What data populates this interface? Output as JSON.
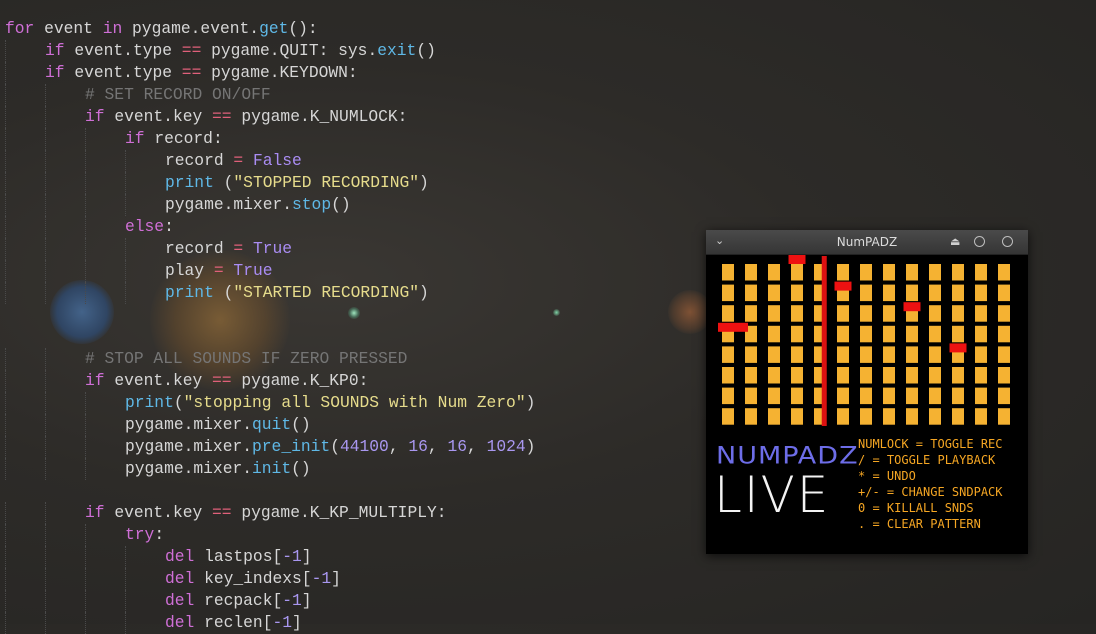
{
  "code_lines": [
    {
      "indent": 0,
      "tokens": [
        {
          "t": "for",
          "c": "kw"
        },
        {
          "t": " event "
        },
        {
          "t": "in",
          "c": "kw"
        },
        {
          "t": " pygame.event."
        },
        {
          "t": "get",
          "c": "fn"
        },
        {
          "t": "():"
        }
      ]
    },
    {
      "indent": 1,
      "tokens": [
        {
          "t": "if",
          "c": "kw"
        },
        {
          "t": " event.type "
        },
        {
          "t": "==",
          "c": "op"
        },
        {
          "t": " pygame.QUIT: sys."
        },
        {
          "t": "exit",
          "c": "fn"
        },
        {
          "t": "()"
        }
      ]
    },
    {
      "indent": 1,
      "tokens": [
        {
          "t": "if",
          "c": "kw"
        },
        {
          "t": " event.type "
        },
        {
          "t": "==",
          "c": "op"
        },
        {
          "t": " pygame.KEYDOWN:"
        }
      ]
    },
    {
      "indent": 2,
      "tokens": [
        {
          "t": "# SET RECORD ON/OFF",
          "c": "cmt"
        }
      ]
    },
    {
      "indent": 2,
      "tokens": [
        {
          "t": "if",
          "c": "kw"
        },
        {
          "t": " event.key "
        },
        {
          "t": "==",
          "c": "op"
        },
        {
          "t": " pygame.K_NUMLOCK:"
        }
      ]
    },
    {
      "indent": 3,
      "tokens": [
        {
          "t": "if",
          "c": "kw"
        },
        {
          "t": " record:"
        }
      ]
    },
    {
      "indent": 4,
      "tokens": [
        {
          "t": "record "
        },
        {
          "t": "=",
          "c": "op"
        },
        {
          "t": " "
        },
        {
          "t": "False",
          "c": "const"
        }
      ]
    },
    {
      "indent": 4,
      "tokens": [
        {
          "t": "print",
          "c": "fn"
        },
        {
          "t": " ("
        },
        {
          "t": "\"STOPPED RECORDING\"",
          "c": "str"
        },
        {
          "t": ")"
        }
      ]
    },
    {
      "indent": 4,
      "tokens": [
        {
          "t": "pygame.mixer."
        },
        {
          "t": "stop",
          "c": "fn"
        },
        {
          "t": "()"
        }
      ]
    },
    {
      "indent": 3,
      "tokens": [
        {
          "t": "else",
          "c": "kw"
        },
        {
          "t": ":"
        }
      ]
    },
    {
      "indent": 4,
      "tokens": [
        {
          "t": "record "
        },
        {
          "t": "=",
          "c": "op"
        },
        {
          "t": " "
        },
        {
          "t": "True",
          "c": "const"
        }
      ]
    },
    {
      "indent": 4,
      "tokens": [
        {
          "t": "play "
        },
        {
          "t": "=",
          "c": "op"
        },
        {
          "t": " "
        },
        {
          "t": "True",
          "c": "const"
        }
      ]
    },
    {
      "indent": 4,
      "tokens": [
        {
          "t": "print",
          "c": "fn"
        },
        {
          "t": " ("
        },
        {
          "t": "\"STARTED RECORDING\"",
          "c": "str"
        },
        {
          "t": ")"
        }
      ]
    },
    {
      "indent": 0,
      "tokens": []
    },
    {
      "indent": 0,
      "tokens": []
    },
    {
      "indent": 2,
      "tokens": [
        {
          "t": "# STOP ALL SOUNDS IF ZERO PRESSED",
          "c": "cmt"
        }
      ]
    },
    {
      "indent": 2,
      "tokens": [
        {
          "t": "if",
          "c": "kw"
        },
        {
          "t": " event.key "
        },
        {
          "t": "==",
          "c": "op"
        },
        {
          "t": " pygame.K_KP0:"
        }
      ]
    },
    {
      "indent": 3,
      "tokens": [
        {
          "t": "print",
          "c": "fn"
        },
        {
          "t": "("
        },
        {
          "t": "\"stopping all SOUNDS with Num Zero\"",
          "c": "str"
        },
        {
          "t": ")"
        }
      ]
    },
    {
      "indent": 3,
      "tokens": [
        {
          "t": "pygame.mixer."
        },
        {
          "t": "quit",
          "c": "fn"
        },
        {
          "t": "()"
        }
      ]
    },
    {
      "indent": 3,
      "tokens": [
        {
          "t": "pygame.mixer."
        },
        {
          "t": "pre_init",
          "c": "fn"
        },
        {
          "t": "("
        },
        {
          "t": "44100",
          "c": "num"
        },
        {
          "t": ", "
        },
        {
          "t": "16",
          "c": "num"
        },
        {
          "t": ", "
        },
        {
          "t": "16",
          "c": "num"
        },
        {
          "t": ", "
        },
        {
          "t": "1024",
          "c": "num"
        },
        {
          "t": ")"
        }
      ]
    },
    {
      "indent": 3,
      "tokens": [
        {
          "t": "pygame.mixer."
        },
        {
          "t": "init",
          "c": "fn"
        },
        {
          "t": "()"
        }
      ]
    },
    {
      "indent": 0,
      "tokens": []
    },
    {
      "indent": 2,
      "tokens": [
        {
          "t": "if",
          "c": "kw"
        },
        {
          "t": " event.key "
        },
        {
          "t": "==",
          "c": "op"
        },
        {
          "t": " pygame.K_KP_MULTIPLY:"
        }
      ]
    },
    {
      "indent": 3,
      "tokens": [
        {
          "t": "try",
          "c": "kw"
        },
        {
          "t": ":"
        }
      ]
    },
    {
      "indent": 4,
      "tokens": [
        {
          "t": "del",
          "c": "kw"
        },
        {
          "t": " lastpos["
        },
        {
          "t": "-1",
          "c": "num"
        },
        {
          "t": "]"
        }
      ]
    },
    {
      "indent": 4,
      "tokens": [
        {
          "t": "del",
          "c": "kw"
        },
        {
          "t": " key_indexs["
        },
        {
          "t": "-1",
          "c": "num"
        },
        {
          "t": "]"
        }
      ]
    },
    {
      "indent": 4,
      "tokens": [
        {
          "t": "del",
          "c": "kw"
        },
        {
          "t": " recpack["
        },
        {
          "t": "-1",
          "c": "num"
        },
        {
          "t": "]"
        }
      ]
    },
    {
      "indent": 4,
      "tokens": [
        {
          "t": "del",
          "c": "kw"
        },
        {
          "t": " reclen["
        },
        {
          "t": "-1",
          "c": "num"
        },
        {
          "t": "]"
        }
      ]
    }
  ],
  "window": {
    "title": "NumPADZ",
    "menu_icon": "chevron-down-icon",
    "eject_icon": "eject-icon",
    "logo_top": "NUMPADZ",
    "logo_bottom": "LIVE",
    "help_lines": [
      "NUMLOCK = TOGGLE REC",
      "/ = TOGGLE PLAYBACK",
      "* = UNDO",
      "+/- = CHANGE SNDPACK",
      "0 = KILLALL SNDS",
      ". = CLEAR PATTERN"
    ]
  },
  "grid": {
    "columns": 13,
    "rows": 8,
    "playhead_column_fraction": 0.355,
    "markers": [
      {
        "col": 3,
        "row": 0
      },
      {
        "col": 5,
        "row": 1
      },
      {
        "col": 8,
        "row": 2
      },
      {
        "col": 0,
        "row": 3,
        "wide": true
      },
      {
        "col": 10,
        "row": 4
      }
    ],
    "cell_color": "#f5b232",
    "marker_color": "#ee1111",
    "playhead_color": "#dd1111"
  },
  "colors": {
    "keyword": "#cf6fd6",
    "operator": "#e0607a",
    "function": "#5fb8e6",
    "string": "#e6dc8c",
    "number": "#a997f0",
    "comment": "#757575",
    "logo_top": "#6d6de8",
    "help_text": "#f5a623"
  }
}
